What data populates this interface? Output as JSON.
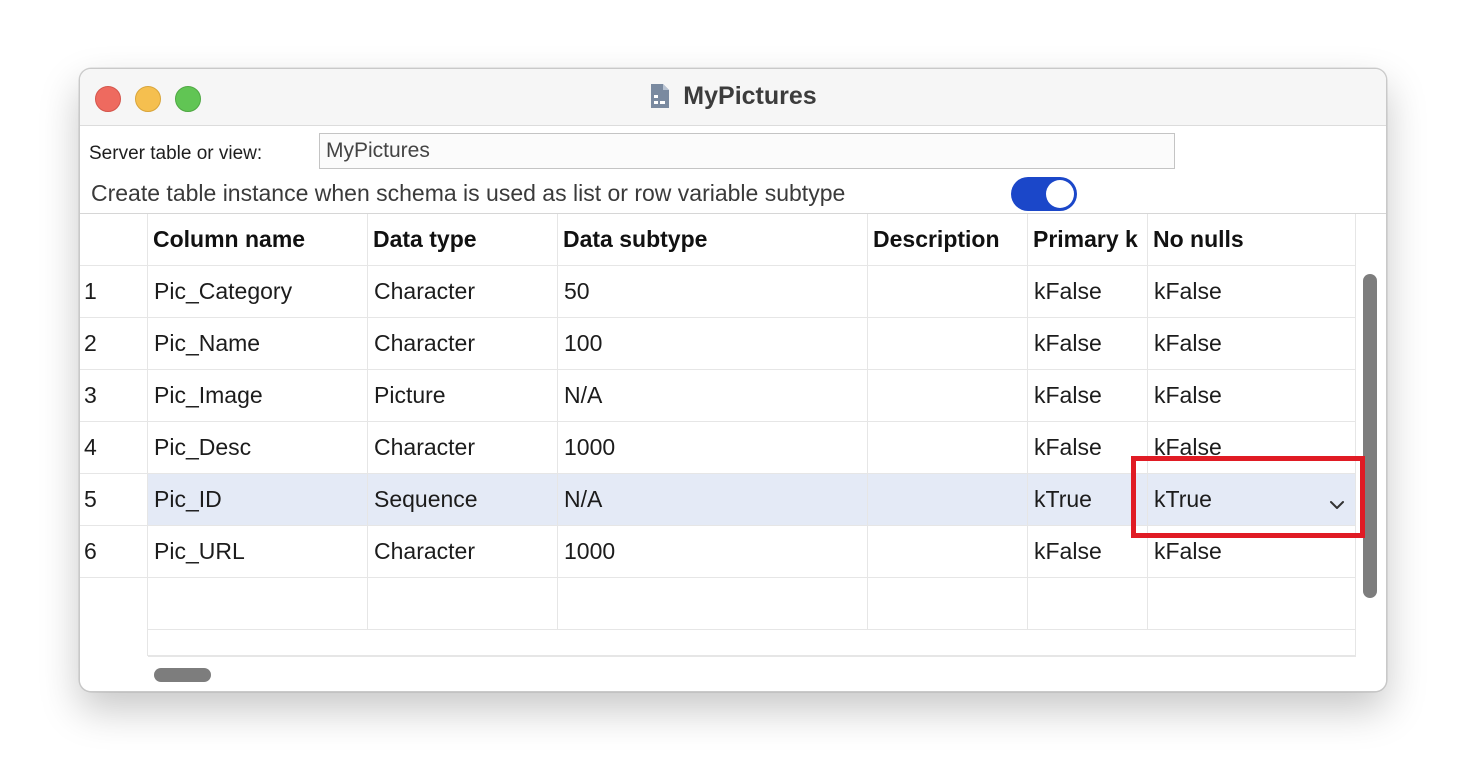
{
  "window": {
    "title": "MyPictures",
    "title_icon": "document-table-icon"
  },
  "form": {
    "server_label": "Server table or view:",
    "server_value": "MyPictures",
    "create_label": "Create table instance when schema is used as list or row variable subtype",
    "create_toggle_on": true,
    "toggle_color": "#1b47c9"
  },
  "table": {
    "headers": [
      "",
      "Column name",
      "Data type",
      "Data subtype",
      "Description",
      "Primary k",
      "No nulls"
    ],
    "rows": [
      {
        "num": "1",
        "name": "Pic_Category",
        "type": "Character",
        "subtype": "50",
        "description": "",
        "primary": "kFalse",
        "nonulls": "kFalse"
      },
      {
        "num": "2",
        "name": "Pic_Name",
        "type": "Character",
        "subtype": "100",
        "description": "",
        "primary": "kFalse",
        "nonulls": "kFalse"
      },
      {
        "num": "3",
        "name": "Pic_Image",
        "type": "Picture",
        "subtype": "N/A",
        "description": "",
        "primary": "kFalse",
        "nonulls": "kFalse"
      },
      {
        "num": "4",
        "name": "Pic_Desc",
        "type": "Character",
        "subtype": "1000",
        "description": "",
        "primary": "kFalse",
        "nonulls": "kFalse"
      },
      {
        "num": "5",
        "name": "Pic_ID",
        "type": "Sequence",
        "subtype": "N/A",
        "description": "",
        "primary": "kTrue",
        "nonulls": "kTrue"
      },
      {
        "num": "6",
        "name": "Pic_URL",
        "type": "Character",
        "subtype": "1000",
        "description": "",
        "primary": "kFalse",
        "nonulls": "kFalse"
      }
    ],
    "selected_row": 5,
    "selected_color": "#e4eaf6",
    "dropdown_icon": "chevron-down-icon",
    "highlight_color": "#e01b24"
  }
}
